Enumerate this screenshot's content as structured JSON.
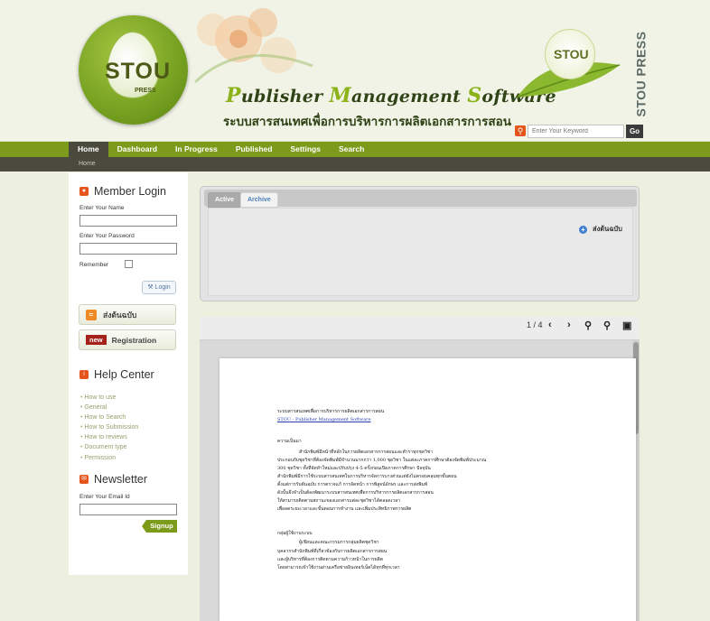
{
  "header": {
    "logo_text": "STOU",
    "logo_press": "PRESS",
    "app_title_parts": [
      {
        "cap": "P",
        "rest": "ublisher "
      },
      {
        "cap": "M",
        "rest": "anagement "
      },
      {
        "cap": "S",
        "rest": "oftware"
      }
    ],
    "app_subtitle": "ระบบสารสนเทศเพื่อการบริหารการผลิตเอกสารการสอน",
    "vertical_press": "STOU PRESS",
    "small_logo_text": "STOU",
    "search": {
      "placeholder": "Enter Your Keyword",
      "go_label": "Go"
    }
  },
  "nav": {
    "items": [
      {
        "label": "Home",
        "active": true
      },
      {
        "label": "Dashboard",
        "active": false
      },
      {
        "label": "In Progress",
        "active": false
      },
      {
        "label": "Published",
        "active": false
      },
      {
        "label": "Settings",
        "active": false
      },
      {
        "label": "Search",
        "active": false
      }
    ],
    "breadcrumb": "Home"
  },
  "sidebar": {
    "member_login": {
      "title": "Member Login",
      "name_label": "Enter Your Name",
      "password_label": "Enter Your Password",
      "remember_label": "Remember",
      "login_label": "Login"
    },
    "send_doc_label": "ส่งต้นฉบับ",
    "new_badge": "new",
    "registration_label": "Registration",
    "help_center": {
      "title": "Help Center",
      "items": [
        "How to use",
        "General",
        "How to Search",
        "How to Submission",
        "How to reviews",
        "Document type",
        "Permission"
      ]
    },
    "newsletter": {
      "title": "Newsletter",
      "email_label": "Enter Your Email Id",
      "signup_label": "Signup"
    }
  },
  "main": {
    "tabs": [
      {
        "label": "Active",
        "active": true
      },
      {
        "label": "Archive",
        "active": false
      }
    ],
    "send_doc_label": "ส่งต้นฉบับ"
  },
  "viewer": {
    "page_indicator": "1 / 4",
    "doc_lines": [
      {
        "text": "ระบบสารสนเทศเพื่อการบริหารการผลิตเอกสารการสอน",
        "indent": 0
      },
      {
        "text": "STOU - Publisher Management Software",
        "indent": 0,
        "link": true
      },
      {
        "text": "ความเป็นมา",
        "indent": 0
      },
      {
        "text": "สำนักพิมพ์มีหน้าที่หลักในการผลิตเอกสารการสอนและตำราทุกชุดวิชา",
        "indent": 1
      },
      {
        "text": "ประกอบกับชุดวิชาที่ต้องจัดพิมพ์มีจำนวนมากกว่า 1,000 ชุดวิชา ในแต่ละภาคการศึกษาต้องจัดพิมพ์ประมาณ",
        "indent": 0
      },
      {
        "text": "300 ชุดวิชา ทั้งที่จัดทำใหม่และปรับปรุง 4-5 ครั้งก่อนเปิดภาคการศึกษา ปัจจุบัน",
        "indent": 0
      },
      {
        "text": "สำนักพิมพ์มีการใช้ระบบสารสนเทศในการบริหารจัดการบางส่วนแต่ยังไม่ครอบคลุมทุกขั้นตอน",
        "indent": 0
      },
      {
        "text": "ตั้งแต่การรับต้นฉบับ การตรวจแก้ การจัดหน้า การพิสูจน์อักษร และการส่งพิมพ์",
        "indent": 0
      },
      {
        "text": "ดังนั้นจึงจำเป็นต้องพัฒนาระบบสารสนเทศเพื่อการบริหารการผลิตเอกสารการสอน",
        "indent": 0
      },
      {
        "text": "ให้สามารถติดตามสถานะของเอกสารแต่ละชุดวิชาได้ตลอดเวลา",
        "indent": 0
      },
      {
        "text": "เพื่อลดระยะเวลาและขั้นตอนการทำงาน และเพิ่มประสิทธิภาพการผลิต",
        "indent": 0
      },
      {
        "text": "กลุ่มผู้ใช้งานระบบ",
        "indent": 0
      },
      {
        "text": "ผู้เขียนและคณะกรรมการกลุ่มผลิตชุดวิชา",
        "indent": 1
      },
      {
        "text": "บุคลากรสำนักพิมพ์ที่เกี่ยวข้องกับการผลิตเอกสารการสอน",
        "indent": 0
      },
      {
        "text": "และผู้บริหารที่ต้องการติดตามความก้าวหน้าในการผลิต",
        "indent": 0
      },
      {
        "text": "โดยสามารถเข้าใช้งานผ่านเครือข่ายอินเทอร์เน็ตได้ทุกที่ทุกเวลา",
        "indent": 0
      }
    ]
  }
}
